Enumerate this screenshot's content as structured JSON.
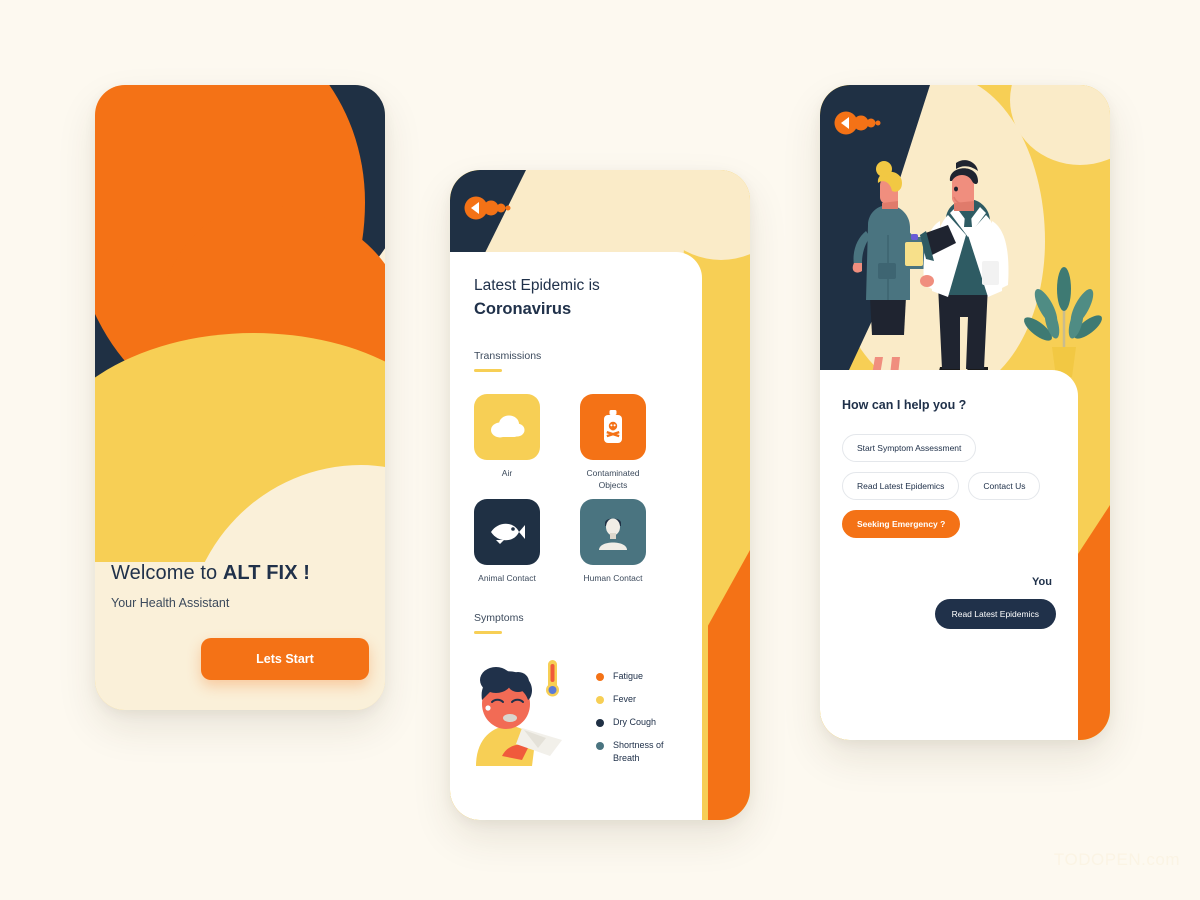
{
  "page": {
    "background": "#FDF9F0",
    "watermark": "TODOPEN.com"
  },
  "colors": {
    "orange": "#F47216",
    "yellow": "#F7CF55",
    "navy": "#1F3044",
    "teal": "#4A7480",
    "cream": "#FAEBC8"
  },
  "phone1": {
    "name": "welcome-screen",
    "title_prefix": "Welcome to ",
    "title_brand": "ALT FIX !",
    "subtitle": "Your Health Assistant",
    "cta_label": "Lets Start"
  },
  "phone2": {
    "name": "epidemic-info-screen",
    "back_icon": "back-arrow-icon",
    "heading_line1": "Latest Epidemic is",
    "heading_line2": "Coronavirus",
    "transmissions": {
      "section_label": "Transmissions",
      "items": [
        {
          "label": "Air",
          "icon": "cloud-icon",
          "color": "#F7CF55"
        },
        {
          "label": "Contaminated Objects",
          "icon": "poison-bottle-icon",
          "color": "#F47216"
        },
        {
          "label": "Animal Contact",
          "icon": "fish-icon",
          "color": "#1F3044"
        },
        {
          "label": "Human Contact",
          "icon": "person-icon",
          "color": "#4A7480"
        }
      ]
    },
    "symptoms": {
      "section_label": "Symptoms",
      "illustration": "sick-person-with-thermometer",
      "legend": [
        {
          "label": "Fatigue",
          "color": "#F47216"
        },
        {
          "label": "Fever",
          "color": "#F7CF55"
        },
        {
          "label": "Dry Cough",
          "color": "#1F3044"
        },
        {
          "label": "Shortness of Breath",
          "color": "#4A7480"
        }
      ]
    }
  },
  "phone3": {
    "name": "chat-assistant-screen",
    "back_icon": "back-arrow-icon",
    "illustration": "two-doctors-with-plant",
    "question": "How can I help you ?",
    "options": [
      {
        "label": "Start Symptom Assessment",
        "style": "outline"
      },
      {
        "label": "Read Latest Epidemics",
        "style": "outline"
      },
      {
        "label": "Contact Us",
        "style": "outline"
      },
      {
        "label": "Seeking Emergency ?",
        "style": "filled"
      }
    ],
    "user_label": "You",
    "user_message": "Read Latest Epidemics"
  }
}
